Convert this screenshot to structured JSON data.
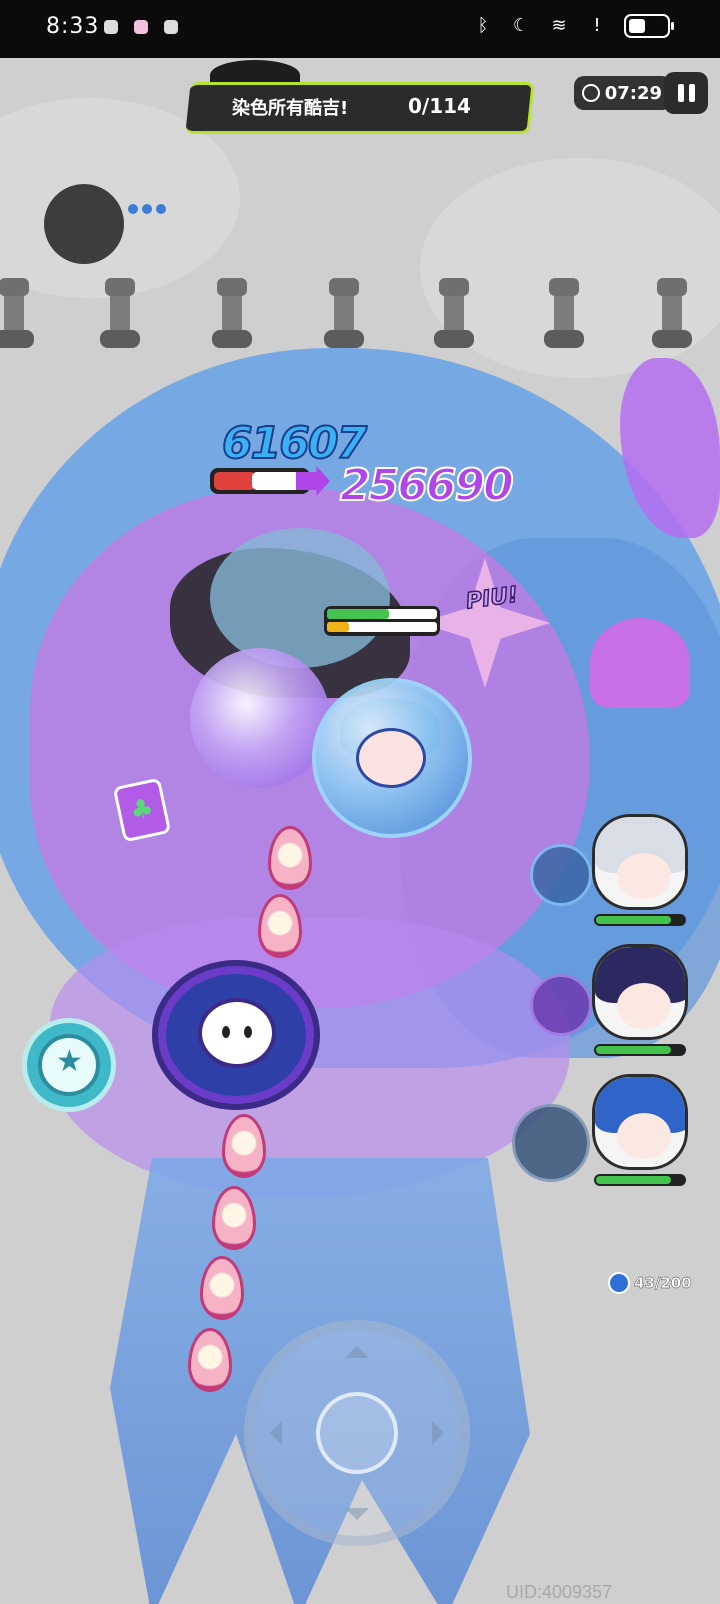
{
  "status_bar": {
    "time": "8:33",
    "icons": [
      "bluetooth-icon",
      "moon-icon",
      "wifi-icon",
      "alert-icon",
      "battery-icon"
    ]
  },
  "mission": {
    "text": "染色所有酷吉!",
    "progress": "0/114"
  },
  "timer": {
    "value": "07:29"
  },
  "damage": {
    "primary": "61607",
    "secondary": "256690"
  },
  "effects": {
    "piu": "PIU!"
  },
  "enemy_hp": {
    "fraction": 0.46
  },
  "player_hp": {
    "hp_fraction": 0.56,
    "shield_fraction": 0.2
  },
  "party": [
    {
      "name": "member-1",
      "hp_fraction": 0.85,
      "hair_color": "#d9dde6"
    },
    {
      "name": "member-2",
      "hp_fraction": 0.85,
      "hair_color": "#2c2860"
    },
    {
      "name": "member-3",
      "hp_fraction": 0.85,
      "hair_color": "#2f64c8"
    }
  ],
  "energy": {
    "value": "43/200"
  },
  "uid": "UID:4009357",
  "colors": {
    "mission_border": "#b9e22a",
    "damage_blue": "#3ab0f5",
    "damage_purple": "#b146e8",
    "hp_green": "#43c34e",
    "hp_red": "#e1413d"
  }
}
